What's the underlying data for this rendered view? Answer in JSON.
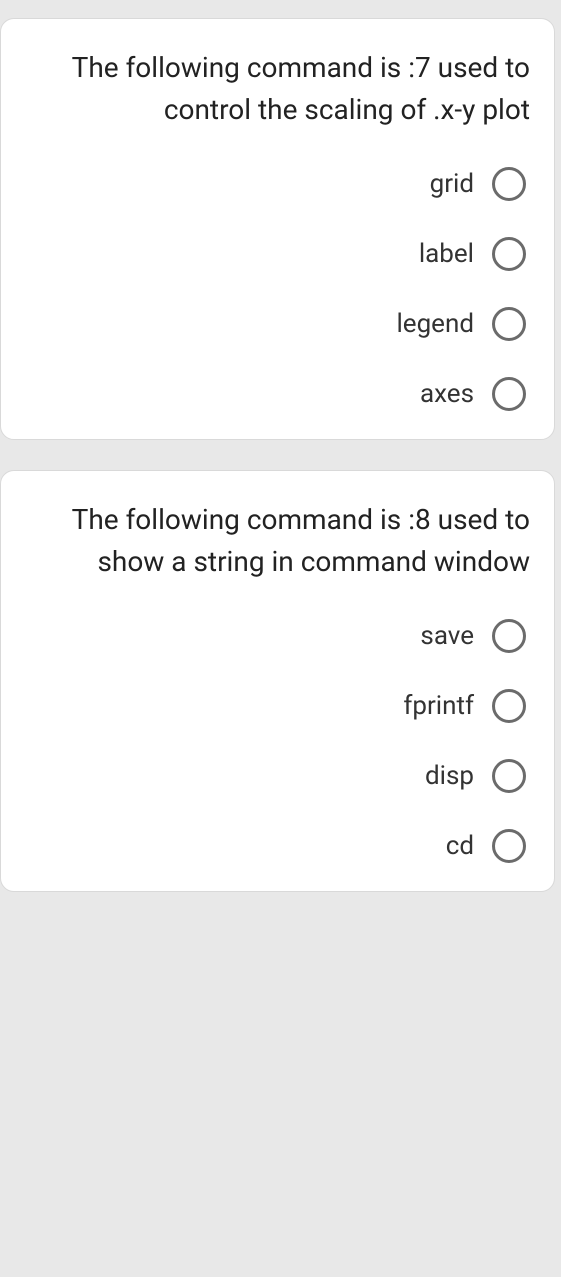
{
  "questions": [
    {
      "number": "7",
      "text": "The following command is :7 used to control the scaling of .x-y plot",
      "options": [
        {
          "label": "grid"
        },
        {
          "label": "label"
        },
        {
          "label": "legend"
        },
        {
          "label": "axes"
        }
      ]
    },
    {
      "number": "8",
      "text": "The following command is :8 used to show a string in command window",
      "options": [
        {
          "label": "save"
        },
        {
          "label": "fprintf"
        },
        {
          "label": "disp"
        },
        {
          "label": "cd"
        }
      ]
    }
  ]
}
